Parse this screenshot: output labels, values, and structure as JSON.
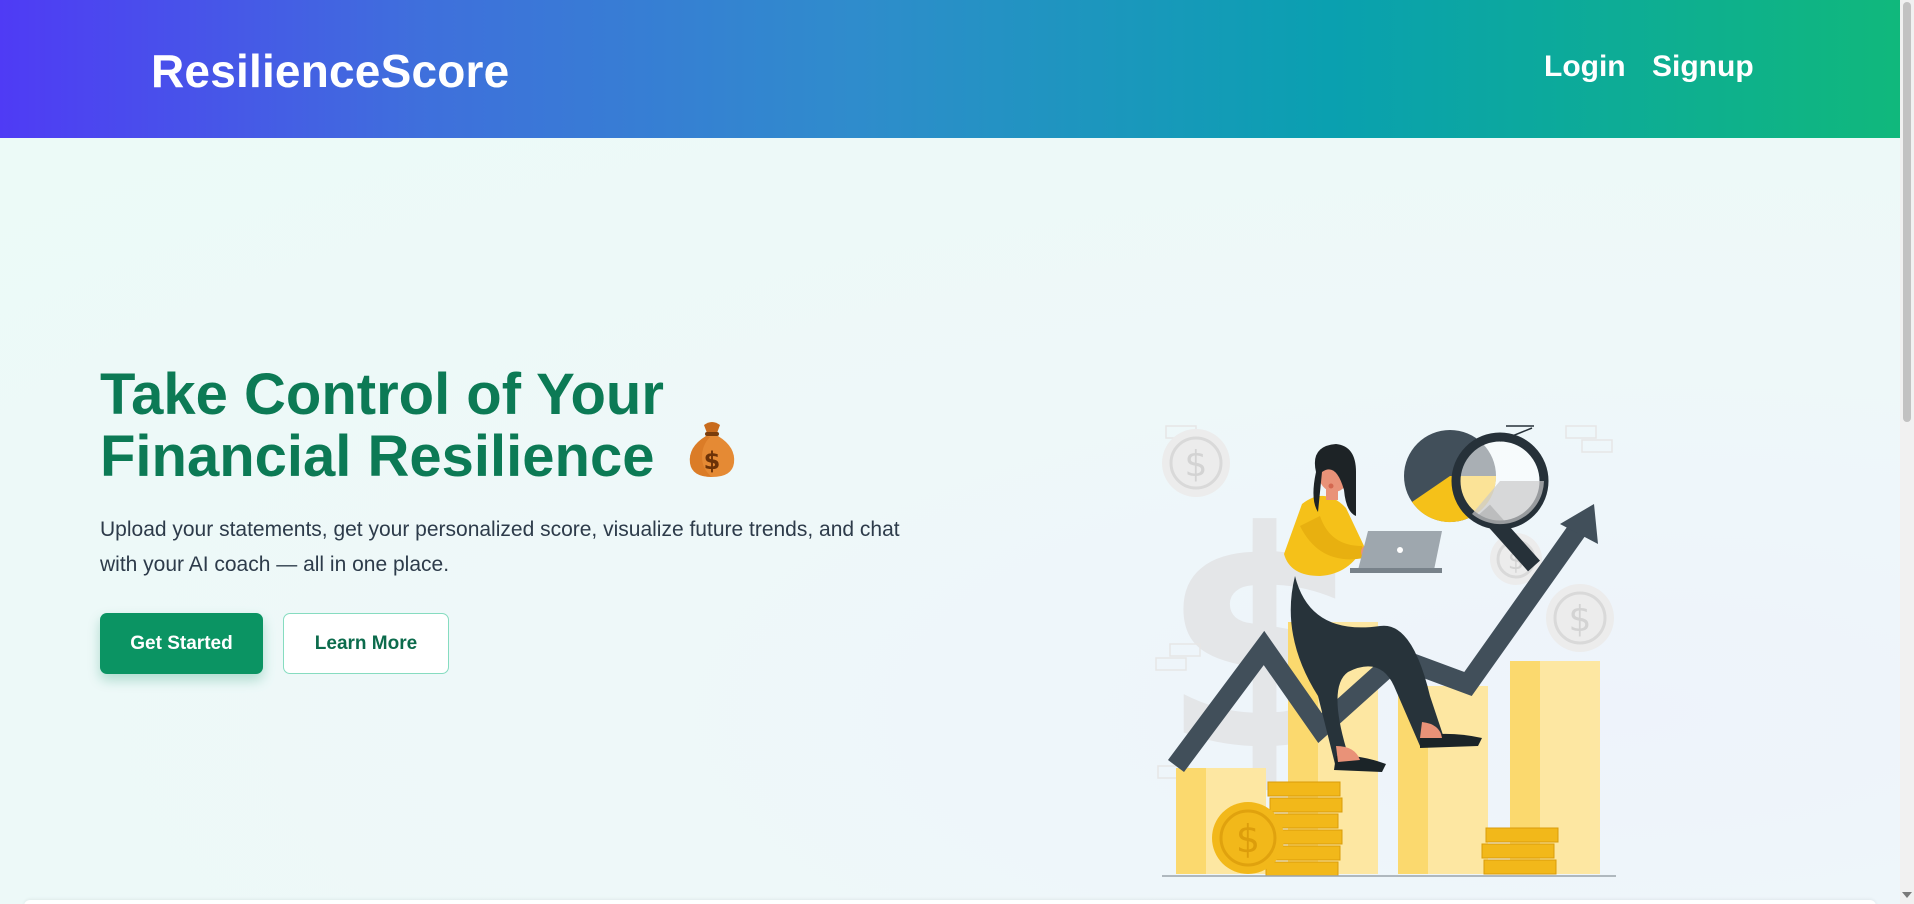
{
  "header": {
    "brand": "ResilienceScore",
    "nav": {
      "login": "Login",
      "signup": "Signup"
    }
  },
  "hero": {
    "title_line1": "Take Control of Your",
    "title_line2": "Financial Resilience",
    "title_emoji": "money-bag-icon",
    "subtitle": "Upload your statements, get your personalized score, visualize future trends, and chat with your AI coach — all in one place.",
    "primary_button": "Get Started",
    "secondary_button": "Learn More",
    "illustration": "woman-on-laptop-with-growth-chart-illustration"
  },
  "colors": {
    "header_gradient": [
      "#4f3bf5",
      "#2f8ccc",
      "#10b87c"
    ],
    "title": "#0c7a55",
    "primary_button": "#0b9463",
    "background": "#eefaf8"
  }
}
